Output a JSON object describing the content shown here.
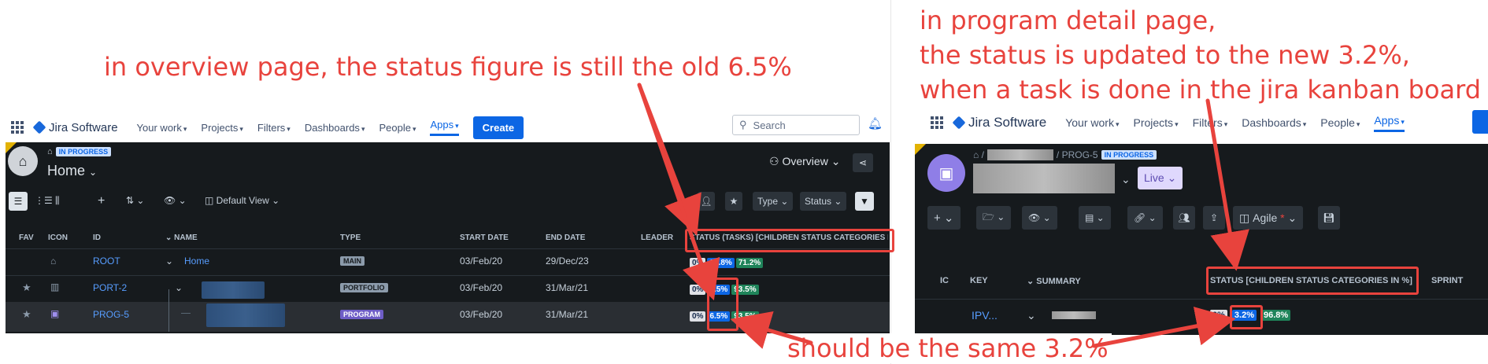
{
  "annotations": {
    "overview_note": "in overview page, the status figure is still the old 6.5%",
    "detail_note_line1": "in program detail page,",
    "detail_note_line2": "the status is updated to the new 3.2%,",
    "detail_note_line3": "when a task is done in the jira kanban board",
    "bottom_note": "should be the same 3.2%"
  },
  "left_app": {
    "logo_text": "Jira Software",
    "nav": {
      "your_work": "Your work",
      "projects": "Projects",
      "filters": "Filters",
      "dashboards": "Dashboards",
      "people": "People",
      "apps": "Apps",
      "create": "Create"
    },
    "search_placeholder": "Search",
    "header": {
      "status_badge": "IN PROGRESS",
      "title": "Home",
      "overview_label": "Overview"
    },
    "toolbar": {
      "default_view": "Default View",
      "type": "Type",
      "status": "Status"
    },
    "columns": {
      "fav": "FAV",
      "icon": "ICON",
      "id": "ID",
      "name": "NAME",
      "type": "TYPE",
      "start_date": "START DATE",
      "end_date": "END DATE",
      "leader": "LEADER",
      "status": "STATUS (TASKS) [CHILDREN STATUS CATEGORIES IN %]"
    },
    "rows": [
      {
        "id": "ROOT",
        "name": "Home",
        "type": "MAIN",
        "start": "03/Feb/20",
        "end": "29/Dec/23",
        "s1": "0%",
        "s2": "28.8%",
        "s3": "71.2%"
      },
      {
        "id": "PORT-2",
        "name": "",
        "type": "PORTFOLIO",
        "start": "03/Feb/20",
        "end": "31/Mar/21",
        "s1": "0%",
        "s2": "6.5%",
        "s3": "93.5%"
      },
      {
        "id": "PROG-5",
        "name": "",
        "type": "PROGRAM",
        "start": "03/Feb/20",
        "end": "31/Mar/21",
        "s1": "0%",
        "s2": "6.5%",
        "s3": "93.5%"
      }
    ]
  },
  "right_app": {
    "logo_text": "Jira Software",
    "nav": {
      "your_work": "Your work",
      "projects": "Projects",
      "filters": "Filters",
      "dashboards": "Dashboards",
      "people": "People",
      "apps": "Apps"
    },
    "breadcrumb_key": "PROG-5",
    "status_badge": "IN PROGRESS",
    "live_button": "Live",
    "agile_label": "Agile",
    "columns": {
      "ic": "IC",
      "key": "KEY",
      "summary": "SUMMARY",
      "status": "STATUS [CHILDREN STATUS CATEGORIES IN %]",
      "sprint": "SPRINT"
    },
    "row": {
      "key": "IPV...",
      "s1": "0%",
      "s2": "3.2%",
      "s3": "96.8%"
    }
  },
  "colors": {
    "annotation_red": "#e8433d",
    "jira_blue": "#0c66e4",
    "dark_panel": "#161a1d",
    "status_green": "#1f845a"
  }
}
